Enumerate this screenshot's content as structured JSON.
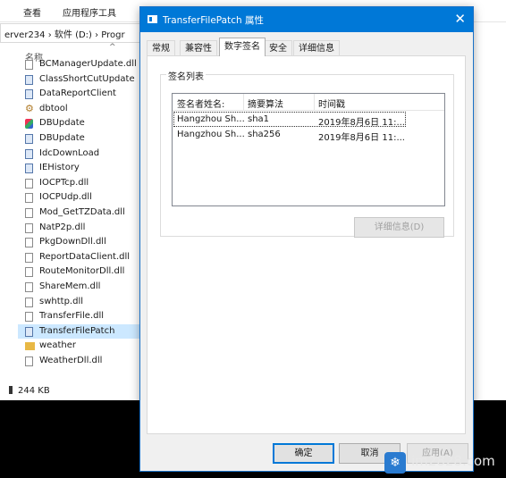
{
  "explorer": {
    "ribbon_tabs": [
      "查看",
      "应用程序工具"
    ],
    "address_path": "erver234  ›  软件 (D:)  ›  Progr",
    "column_header": "名称",
    "files": [
      {
        "name": "BCManagerUpdate.dll",
        "icon": "dll-file-icon"
      },
      {
        "name": "ClassShortCutUpdate",
        "icon": "exe-file-icon"
      },
      {
        "name": "DataReportClient",
        "icon": "exe-file-icon"
      },
      {
        "name": "dbtool",
        "icon": "gear-app-icon"
      },
      {
        "name": "DBUpdate",
        "icon": "color-app-icon"
      },
      {
        "name": "DBUpdate",
        "icon": "exe-file-icon"
      },
      {
        "name": "IdcDownLoad",
        "icon": "exe-file-icon"
      },
      {
        "name": "IEHistory",
        "icon": "exe-file-icon"
      },
      {
        "name": "IOCPTcp.dll",
        "icon": "dll-file-icon"
      },
      {
        "name": "IOCPUdp.dll",
        "icon": "dll-file-icon"
      },
      {
        "name": "Mod_GetTZData.dll",
        "icon": "dll-file-icon"
      },
      {
        "name": "NatP2p.dll",
        "icon": "dll-file-icon"
      },
      {
        "name": "PkgDownDll.dll",
        "icon": "dll-file-icon"
      },
      {
        "name": "ReportDataClient.dll",
        "icon": "dll-file-icon"
      },
      {
        "name": "RouteMonitorDll.dll",
        "icon": "dll-file-icon"
      },
      {
        "name": "ShareMem.dll",
        "icon": "dll-file-icon"
      },
      {
        "name": "swhttp.dll",
        "icon": "dll-file-icon"
      },
      {
        "name": "TransferFile.dll",
        "icon": "dll-file-icon"
      },
      {
        "name": "TransferFilePatch",
        "icon": "exe-file-icon",
        "selected": true
      },
      {
        "name": "weather",
        "icon": "folder-icon"
      },
      {
        "name": "WeatherDll.dll",
        "icon": "dll-file-icon"
      }
    ],
    "status_size": "244 KB"
  },
  "dialog": {
    "title": "TransferFilePatch 属性",
    "close_glyph": "✕",
    "tabs": [
      {
        "label": "常规",
        "active": false
      },
      {
        "label": "兼容性",
        "active": false
      },
      {
        "label": "数字签名",
        "active": true
      },
      {
        "label": "安全",
        "active": false
      },
      {
        "label": "详细信息",
        "active": false
      }
    ],
    "signature_group_label": "签名列表",
    "columns": [
      "签名者姓名:",
      "摘要算法",
      "时间戳"
    ],
    "signatures": [
      {
        "signer": "Hangzhou Sh...",
        "digest": "sha1",
        "timestamp": "2019年8月6日 11:..."
      },
      {
        "signer": "Hangzhou Sh...",
        "digest": "sha256",
        "timestamp": "2019年8月6日 11:..."
      }
    ],
    "details_button": "详细信息(D)",
    "ok_button": "确定",
    "cancel_button": "取消",
    "apply_button": "应用(A)"
  },
  "watermark": {
    "text": "im2828.com",
    "logo_glyph": "❄"
  },
  "colors": {
    "titlebar": "#0078d7",
    "selection": "#cce8ff"
  }
}
